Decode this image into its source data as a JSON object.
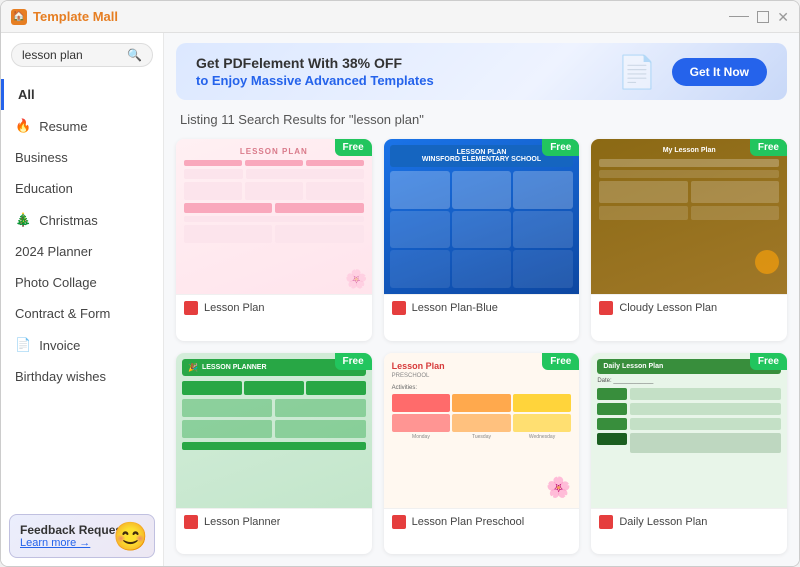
{
  "window": {
    "title": "Template Mall"
  },
  "search": {
    "value": "lesson plan",
    "placeholder": "lesson plan"
  },
  "banner": {
    "line1": "Get PDFelement With 38% OFF",
    "line2_prefix": "to Enjoy Massive ",
    "line2_highlight": "Advanced Templates",
    "button_label": "Get It Now"
  },
  "results": {
    "header": "Listing 11 Search Results for \"lesson plan\""
  },
  "sidebar": {
    "items": [
      {
        "id": "all",
        "label": "All",
        "icon": ""
      },
      {
        "id": "resume",
        "label": "Resume",
        "icon": "🔥"
      },
      {
        "id": "business",
        "label": "Business",
        "icon": ""
      },
      {
        "id": "education",
        "label": "Education",
        "icon": ""
      },
      {
        "id": "christmas",
        "label": "Christmas",
        "icon": "🎄"
      },
      {
        "id": "planner",
        "label": "2024 Planner",
        "icon": ""
      },
      {
        "id": "photo-collage",
        "label": "Photo Collage",
        "icon": ""
      },
      {
        "id": "contract",
        "label": "Contract & Form",
        "icon": ""
      },
      {
        "id": "invoice",
        "label": "Invoice",
        "icon": "📄"
      },
      {
        "id": "birthday",
        "label": "Birthday wishes",
        "icon": ""
      }
    ]
  },
  "feedback": {
    "title": "Feedback Request",
    "link_text": "Learn more →"
  },
  "templates": [
    {
      "id": "t1",
      "name": "Lesson Plan",
      "type": "pdf",
      "badge": "Free",
      "style": "pink"
    },
    {
      "id": "t2",
      "name": "Lesson Plan-Blue",
      "type": "pdf",
      "badge": "Free",
      "style": "blue"
    },
    {
      "id": "t3",
      "name": "Cloudy Lesson Plan",
      "type": "pdf",
      "badge": "Free",
      "style": "brown"
    },
    {
      "id": "t4",
      "name": "Lesson Planner",
      "type": "pdf",
      "badge": "Free",
      "style": "green"
    },
    {
      "id": "t5",
      "name": "Lesson Plan Preschool",
      "type": "pdf",
      "badge": "Free",
      "style": "preschool"
    },
    {
      "id": "t6",
      "name": "Daily Lesson Plan",
      "type": "pdf",
      "badge": "Free",
      "style": "daily"
    }
  ]
}
